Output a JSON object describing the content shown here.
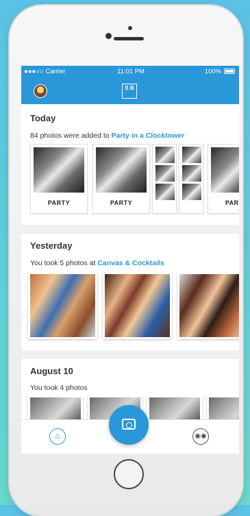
{
  "status_bar": {
    "carrier": "●●●○○ Carrier",
    "time": "11:01 PM",
    "battery": "100%"
  },
  "app_bar": {
    "logo_text": "S B"
  },
  "sections": [
    {
      "title": "Today",
      "subtitle_prefix": "84 photos were added to ",
      "subtitle_link": "Party in a Clocktower",
      "card_label": "PARTY"
    },
    {
      "title": "Yesterday",
      "subtitle_prefix": "You took 5 photos at ",
      "subtitle_link": "Canvas & Cocktails"
    },
    {
      "title": "August 10",
      "subtitle_prefix": "You took 4 photos"
    }
  ],
  "tab_bar": {
    "home_icon": "home-icon",
    "camera_icon": "camera-icon",
    "discover_icon": "binoculars-icon"
  },
  "colors": {
    "accent": "#2a97d9",
    "background": "#5cc2e6"
  }
}
